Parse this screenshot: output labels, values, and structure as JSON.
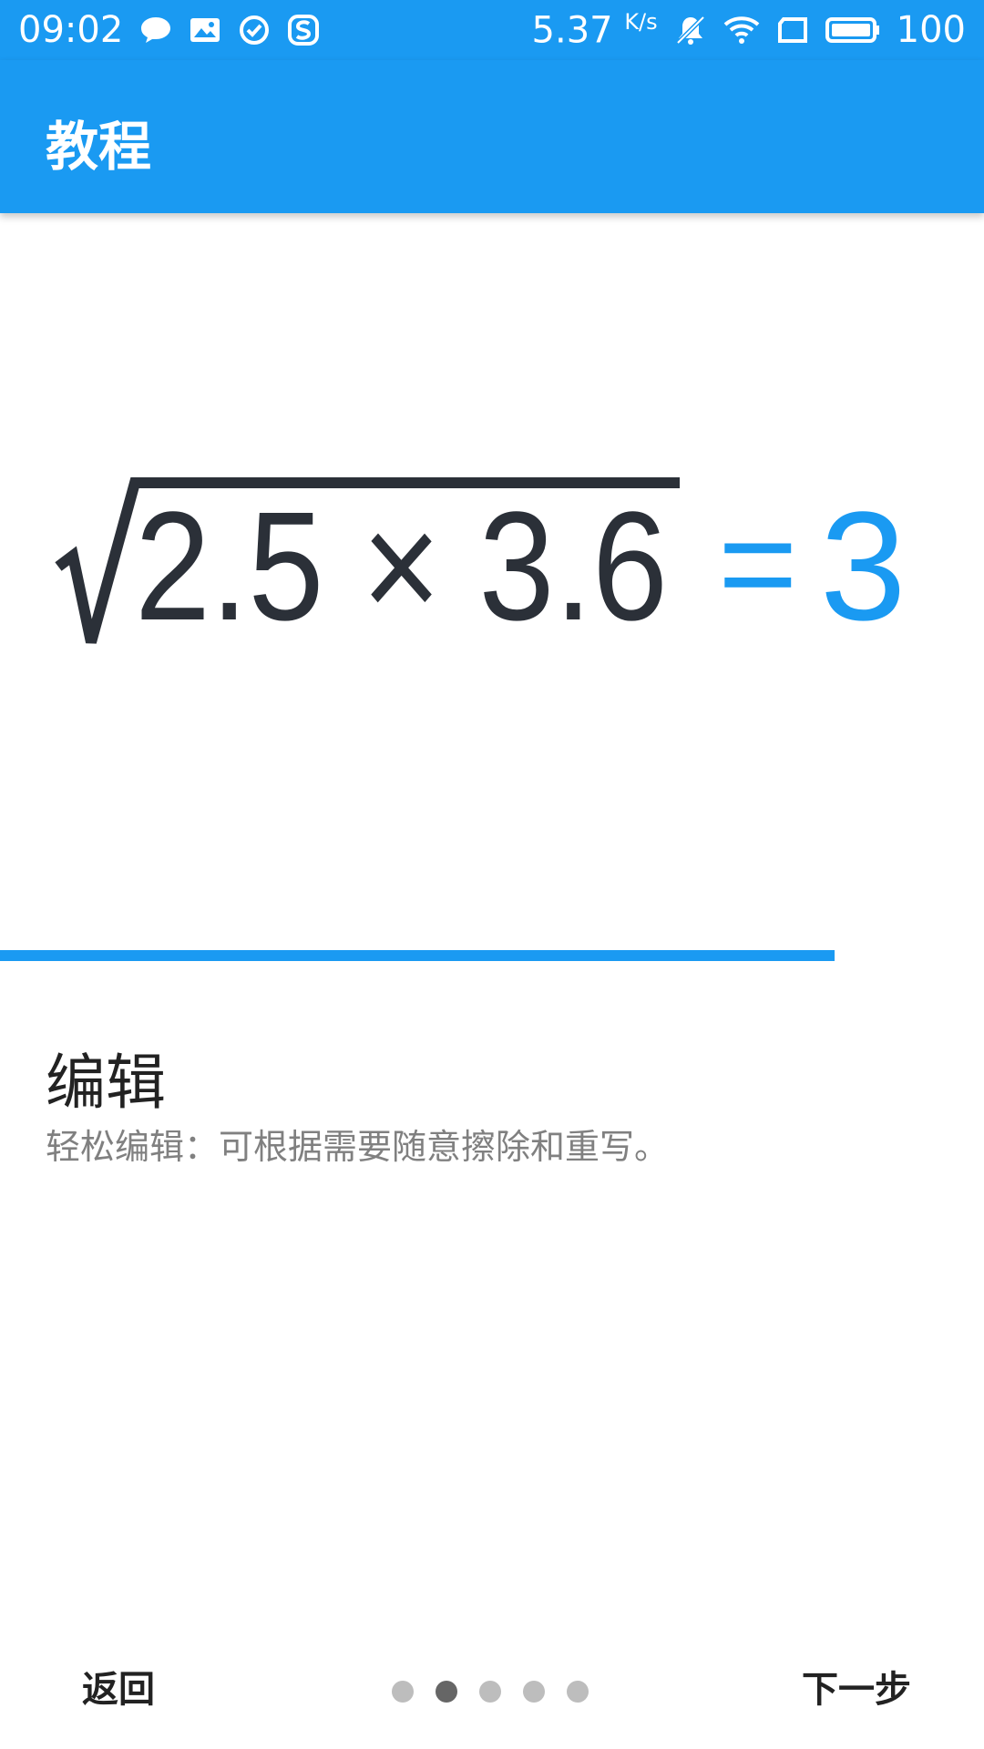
{
  "status_bar": {
    "time": "09:02",
    "speed_value": "5.37",
    "speed_unit": "K/s",
    "battery": "100",
    "left_icons": [
      "chat-bubble-icon",
      "image-icon",
      "check-circle-icon",
      "sogou-icon"
    ],
    "right_icons": [
      "bell-off-icon",
      "wifi-icon",
      "sim-card-icon",
      "battery-icon"
    ]
  },
  "app_bar": {
    "title": "教程"
  },
  "illustration": {
    "expression": "2.5 × 3.6",
    "equals": "=",
    "result": "3"
  },
  "progress": {
    "fill_fraction": 0.848
  },
  "content": {
    "heading": "编辑",
    "description": "轻松编辑：可根据需要随意擦除和重写。"
  },
  "navigation": {
    "back_label": "返回",
    "next_label": "下一步",
    "page_count": 5,
    "active_page": 2
  },
  "colors": {
    "accent": "#1a9af2",
    "ink": "#2b3038",
    "dot_inactive": "#bdbdbd",
    "dot_active": "#666666"
  }
}
